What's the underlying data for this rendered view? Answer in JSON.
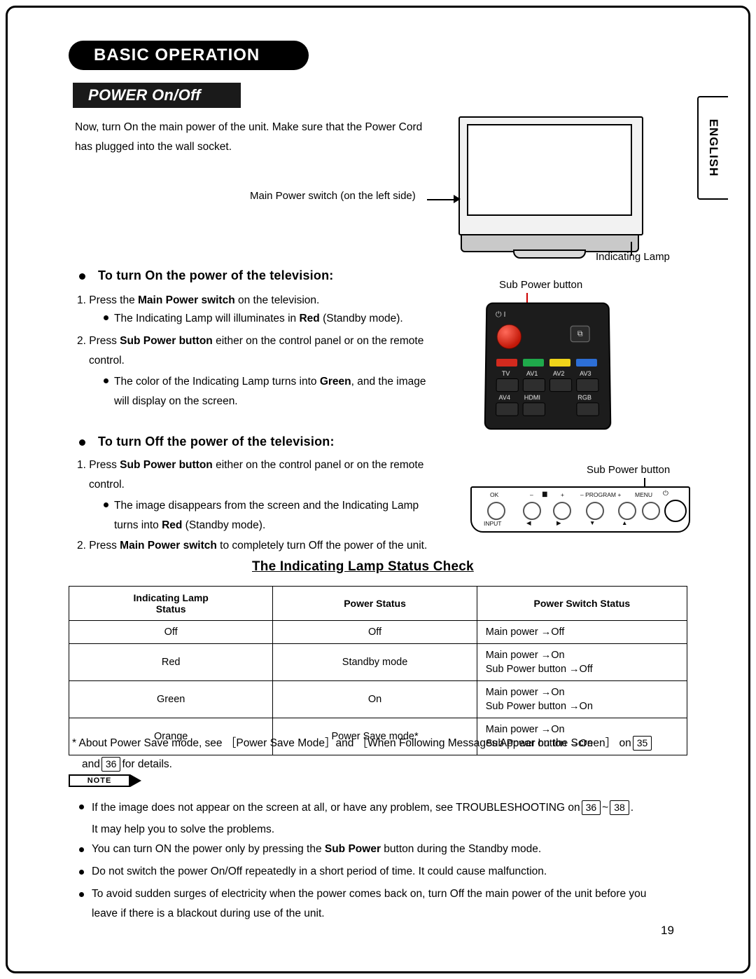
{
  "header": {
    "section_title": "BASIC OPERATION",
    "subsection_title": "POWER On/Off",
    "language_tab": "ENGLISH"
  },
  "intro": {
    "line1": "Now, turn On the main power of the unit. Make sure that the Power Cord",
    "line2": "has plugged into the wall socket."
  },
  "callouts": {
    "main_power_switch": "Main Power switch (on the left side)",
    "indicating_lamp": "Indicating Lamp",
    "sub_power_button_remote": "Sub Power button",
    "sub_power_button_panel": "Sub Power button"
  },
  "turn_on": {
    "heading": "To turn On the power of the television:",
    "step1_pre": "1. Press the ",
    "step1_bold": "Main Power switch",
    "step1_post": " on the television.",
    "sub1_pre": "The Indicating Lamp will illuminates in ",
    "sub1_bold": "Red",
    "sub1_post": " (Standby mode).",
    "step2_pre": "2. Press ",
    "step2_bold": "Sub Power button",
    "step2_post": " either on the control panel or on the remote",
    "step2_cont": "control.",
    "sub2_pre": "The color of the Indicating Lamp turns into ",
    "sub2_bold": "Green",
    "sub2_post": ", and the image",
    "sub2_cont": "will display on the screen."
  },
  "turn_off": {
    "heading": "To turn Off the power of the television:",
    "step1_pre": "1. Press ",
    "step1_bold": "Sub Power button",
    "step1_post": " either on the control panel or on the remote",
    "step1_cont": "control.",
    "sub1_pre": "The image disappears from the screen and the Indicating Lamp",
    "sub1_cont_pre": "turns into ",
    "sub1_cont_bold": "Red",
    "sub1_cont_post": " (Standby mode).",
    "step2_pre": "2. Press ",
    "step2_bold": "Main Power switch",
    "step2_post": " to completely turn Off the power of the unit."
  },
  "remote": {
    "power_symbol": "⏻ I",
    "buttons": [
      "TV",
      "AV1",
      "AV2",
      "AV3"
    ],
    "buttons2": [
      "AV4",
      "HDMI",
      "RGB"
    ],
    "screen_icon": "⧉"
  },
  "panel": {
    "labels_top": [
      "OK",
      "–",
      "▆",
      "+",
      "– PROGRAM +",
      "MENU"
    ],
    "labels_bottom": [
      "INPUT",
      "◀",
      "▶",
      "▼",
      "▲"
    ],
    "power_symbol": "⏻"
  },
  "table": {
    "title": "The Indicating Lamp Status Check",
    "headers": [
      "Indicating Lamp\nStatus",
      "Power Status",
      "Power Switch Status"
    ],
    "header_col1_line1": "Indicating Lamp",
    "header_col1_line2": "Status",
    "header_col2": "Power Status",
    "header_col3": "Power Switch Status",
    "rows": [
      {
        "lamp": "Off",
        "power": "Off",
        "switch_l1": "Main power  →Off",
        "switch_l2": ""
      },
      {
        "lamp": "Red",
        "power": "Standby mode",
        "switch_l1": "Main power  →On",
        "switch_l2": "Sub Power button →Off"
      },
      {
        "lamp": "Green",
        "power": "On",
        "switch_l1": "Main power  →On",
        "switch_l2": "Sub Power button  →On"
      },
      {
        "lamp": "Orange",
        "power": "Power Save mode*",
        "switch_l1": "Main power  →On",
        "switch_l2": "Sub Power button  →On"
      }
    ]
  },
  "footnote": {
    "part1": "* About Power Save mode, see ［Power Save Mode］and ［When Following Messages Appear on the Screen］ on",
    "page1": "35",
    "part2": "and",
    "page2": "36",
    "part3": "for details."
  },
  "note": {
    "flag": "NOTE",
    "items": [
      {
        "pre": "If the image does not appear on the screen at all, or have any problem, see TROUBLESHOOTING on",
        "page1": "36",
        "mid": "~",
        "page2": "38",
        "post": ".",
        "line2": "It may help you to solve the problems."
      },
      {
        "pre": "You can turn ON the power only by pressing the ",
        "bold": "Sub Power",
        "post": " button during the Standby mode."
      },
      {
        "pre": "Do not switch the power On/Off repeatedly in a short period of time. It could cause malfunction."
      },
      {
        "pre": "To avoid sudden surges of electricity when the power comes back on, turn Off the main power of the unit before you",
        "line2": "leave if there is a blackout during use of the unit."
      }
    ]
  },
  "page_number": "19"
}
